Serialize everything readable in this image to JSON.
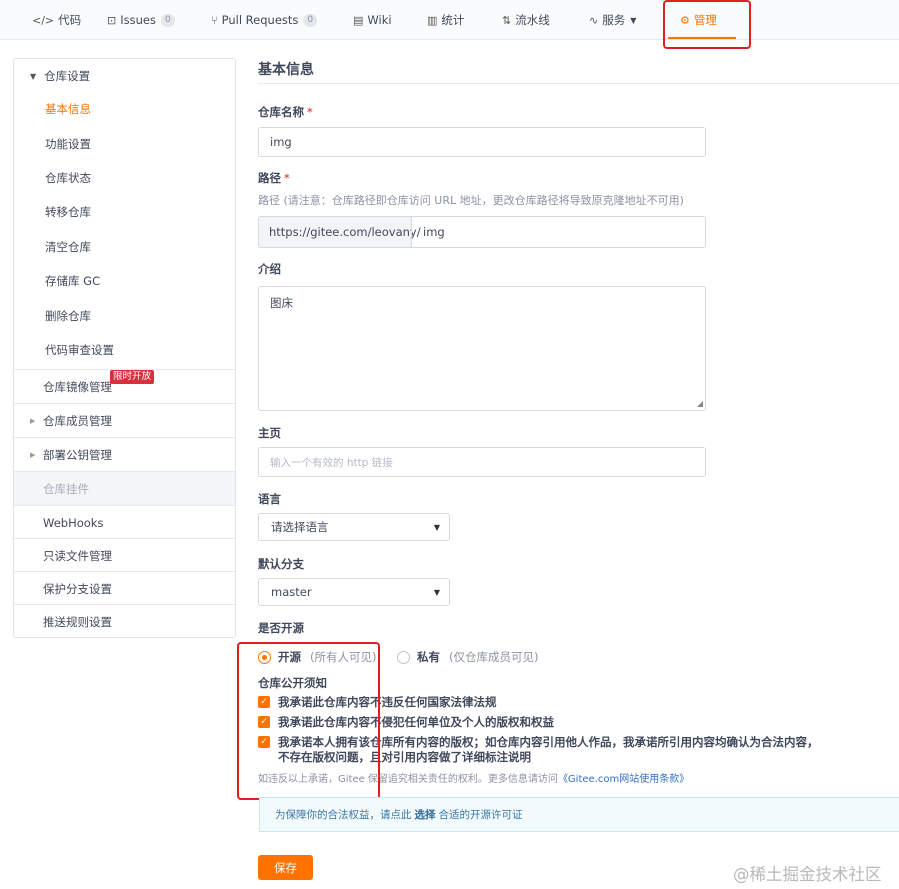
{
  "nav": {
    "tabs": [
      {
        "label": "代码",
        "icon": "code-icon",
        "icon_glyph": "</>"
      },
      {
        "label": "Issues",
        "icon": "issues-icon",
        "icon_glyph": "⊡",
        "count": "0"
      },
      {
        "label": "Pull Requests",
        "icon": "pull-request-icon",
        "icon_glyph": "⑂",
        "count": "0"
      },
      {
        "label": "Wiki",
        "icon": "wiki-icon",
        "icon_glyph": "▤"
      },
      {
        "label": "统计",
        "icon": "stats-icon",
        "icon_glyph": "▥"
      },
      {
        "label": "流水线",
        "icon": "pipeline-icon",
        "icon_glyph": "⇅"
      },
      {
        "label": "服务",
        "icon": "service-icon",
        "icon_glyph": "∿"
      },
      {
        "label": "管理",
        "icon": "manage-icon",
        "icon_glyph": "⚙"
      }
    ],
    "active_tab": "管理"
  },
  "sidebar": {
    "group_title": "仓库设置",
    "sub_items": [
      "基本信息",
      "功能设置",
      "仓库状态",
      "转移仓库",
      "清空仓库",
      "存储库 GC",
      "删除仓库",
      "代码审查设置"
    ],
    "items": [
      {
        "label": "仓库镜像管理",
        "badge": "限时开放"
      },
      {
        "label": "仓库成员管理"
      },
      {
        "label": "部署公钥管理"
      },
      {
        "label": "仓库挂件"
      },
      {
        "label": "WebHooks"
      },
      {
        "label": "只读文件管理"
      },
      {
        "label": "保护分支设置"
      },
      {
        "label": "推送规则设置"
      }
    ]
  },
  "main": {
    "title": "基本信息",
    "repo_name_label": "仓库名称",
    "required_mark": "*",
    "repo_name_value": "img",
    "path_label": "路径",
    "path_hint": "路径 (请注意：仓库路径即仓库访问 URL 地址，更改仓库路径将导致原克隆地址不可用)",
    "path_prefix": "https://gitee.com/leovany/",
    "path_value": "img",
    "intro_label": "介绍",
    "intro_value": "图床",
    "homepage_label": "主页",
    "homepage_placeholder": "输入一个有效的 http 链接",
    "language_label": "语言",
    "language_value": "请选择语言",
    "branch_label": "默认分支",
    "branch_value": "master",
    "open_source_label": "是否开源",
    "radio_open": "开源",
    "radio_open_note": "(所有人可见)",
    "radio_private": "私有",
    "radio_private_note": "(仅仓库成员可见)",
    "notice_title": "仓库公开须知",
    "checkbox_1": "我承诺此仓库内容不违反任何国家法律法规",
    "checkbox_2": "我承诺此仓库内容不侵犯任何单位及个人的版权和权益",
    "checkbox_3_line1": "我承诺本人拥有该仓库所有内容的版权；如仓库内容引用他人作品，我承诺所引用内容均确认为合法内容，",
    "checkbox_3_line2": "不存在版权问题，且对引用内容做了详细标注说明",
    "disclaimer": "如违反以上承诺，Gitee 保留追究相关责任的权利。更多信息请访问",
    "disclaimer_link": "《Gitee.com网站使用条款》",
    "info_pre": "为保障你的合法权益，请点此",
    "info_link": "选择",
    "info_post": "合适的开源许可证",
    "save_label": "保存"
  },
  "watermark": "@稀土掘金技术社区",
  "colors": {
    "accent": "#fe7300",
    "highlight": "#e02020",
    "link": "#3270c3"
  }
}
